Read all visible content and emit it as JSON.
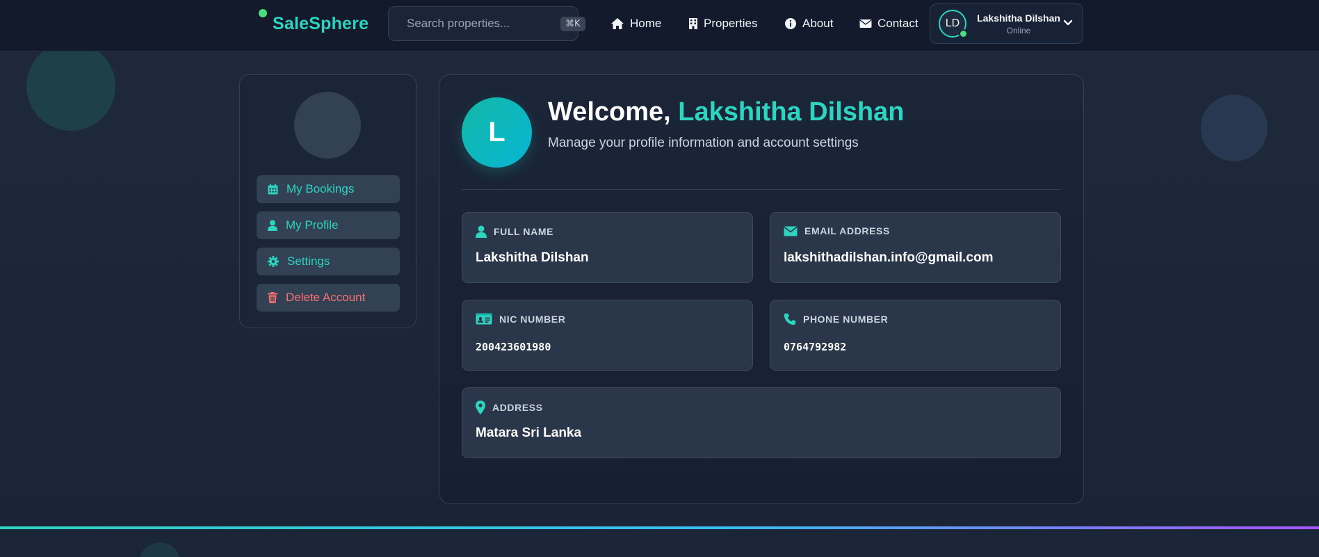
{
  "brand": {
    "name": "SaleSphere",
    "accent": "#2dd4bf"
  },
  "search": {
    "placeholder": "Search properties...",
    "shortcut": "⌘K"
  },
  "nav": [
    {
      "label": "Home",
      "icon": "home-icon"
    },
    {
      "label": "Properties",
      "icon": "building-icon"
    },
    {
      "label": "About",
      "icon": "info-icon"
    },
    {
      "label": "Contact",
      "icon": "envelope-icon"
    }
  ],
  "user": {
    "initials": "LD",
    "name": "Lakshitha Dilshan",
    "status": "Online"
  },
  "sidebar": {
    "items": [
      {
        "label": "My Bookings",
        "icon": "calendar-icon"
      },
      {
        "label": "My Profile",
        "icon": "user-icon"
      },
      {
        "label": "Settings",
        "icon": "gear-icon"
      },
      {
        "label": "Delete Account",
        "icon": "trash-icon",
        "color": "#f87171"
      }
    ]
  },
  "profile": {
    "initial": "L",
    "welcome_prefix": "Welcome, ",
    "welcome_name": "Lakshitha Dilshan",
    "subtitle": "Manage your profile information and account settings",
    "fields": {
      "full_name": {
        "label": "FULL NAME",
        "value": "Lakshitha Dilshan",
        "icon": "user-icon"
      },
      "email": {
        "label": "EMAIL ADDRESS",
        "value": "lakshithadilshan.info@gmail.com",
        "icon": "envelope-icon"
      },
      "nic": {
        "label": "NIC NUMBER",
        "value": "200423601980",
        "icon": "id-card-icon"
      },
      "phone": {
        "label": "PHONE NUMBER",
        "value": "0764792982",
        "icon": "phone-icon"
      },
      "address": {
        "label": "ADDRESS",
        "value": "Matara Sri Lanka",
        "icon": "map-pin-icon"
      }
    }
  },
  "colors": {
    "background": "#1e293b",
    "teal": "#2dd4bf",
    "danger": "#f87171",
    "online": "#4ade80"
  }
}
